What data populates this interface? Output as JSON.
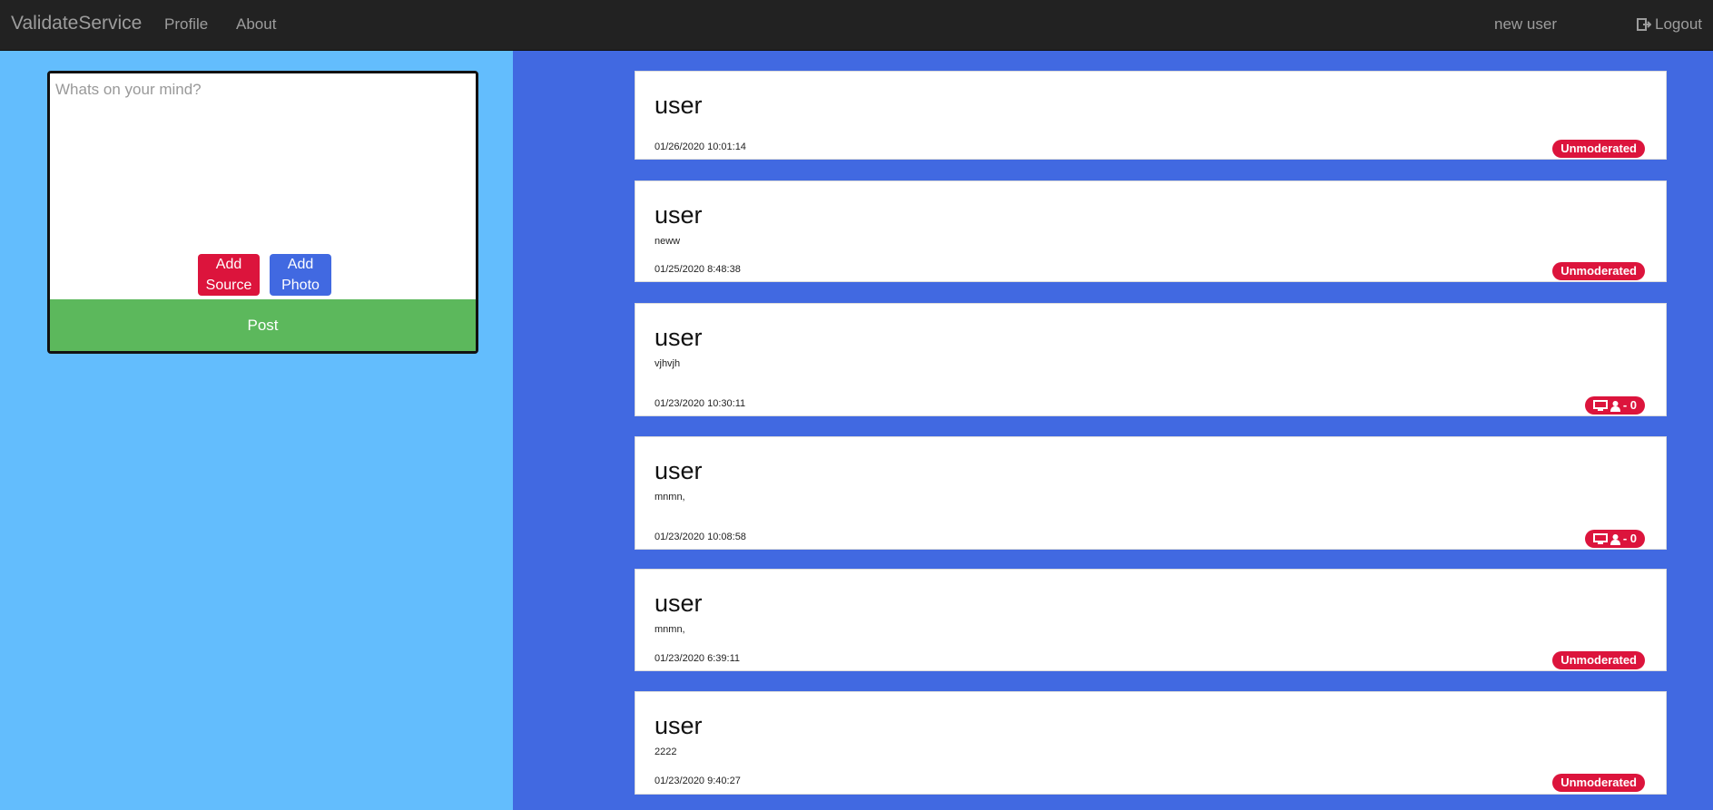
{
  "nav": {
    "brand": "ValidateService",
    "links": [
      "Profile",
      "About"
    ],
    "user": "new user",
    "logout": "Logout"
  },
  "composer": {
    "placeholder": "Whats on your mind?",
    "add_source_line1": "Add",
    "add_source_line2": "Source",
    "add_photo_line1": "Add",
    "add_photo_line2": "Photo",
    "post": "Post"
  },
  "posts": [
    {
      "user": "user",
      "body": "",
      "timestamp": "01/26/2020 10:01:14",
      "badge": "Unmoderated"
    },
    {
      "user": "user",
      "body": "neww",
      "timestamp": "01/25/2020 8:48:38",
      "badge": "Unmoderated"
    },
    {
      "user": "user",
      "body": "vjhvjh",
      "timestamp": "01/23/2020 10:30:11",
      "badge": "- 0",
      "badge_icons": [
        "monitor-icon",
        "user-icon"
      ]
    },
    {
      "user": "user",
      "body": "mnmn,",
      "timestamp": "01/23/2020 10:08:58",
      "badge": "- 0",
      "badge_icons": [
        "monitor-icon",
        "user-icon"
      ]
    },
    {
      "user": "user",
      "body": "mnmn,",
      "timestamp": "01/23/2020 6:39:11",
      "badge": "Unmoderated"
    },
    {
      "user": "user",
      "body": "2222",
      "timestamp": "01/23/2020 9:40:27",
      "badge": "Unmoderated"
    }
  ],
  "colors": {
    "navbar": "#222222",
    "left_panel": "#63bdfd",
    "right_panel": "#4169e1",
    "badge": "#dc143c",
    "post_button": "#5cb85c",
    "add_source_button": "#dc143c",
    "add_photo_button": "#4169e1"
  }
}
